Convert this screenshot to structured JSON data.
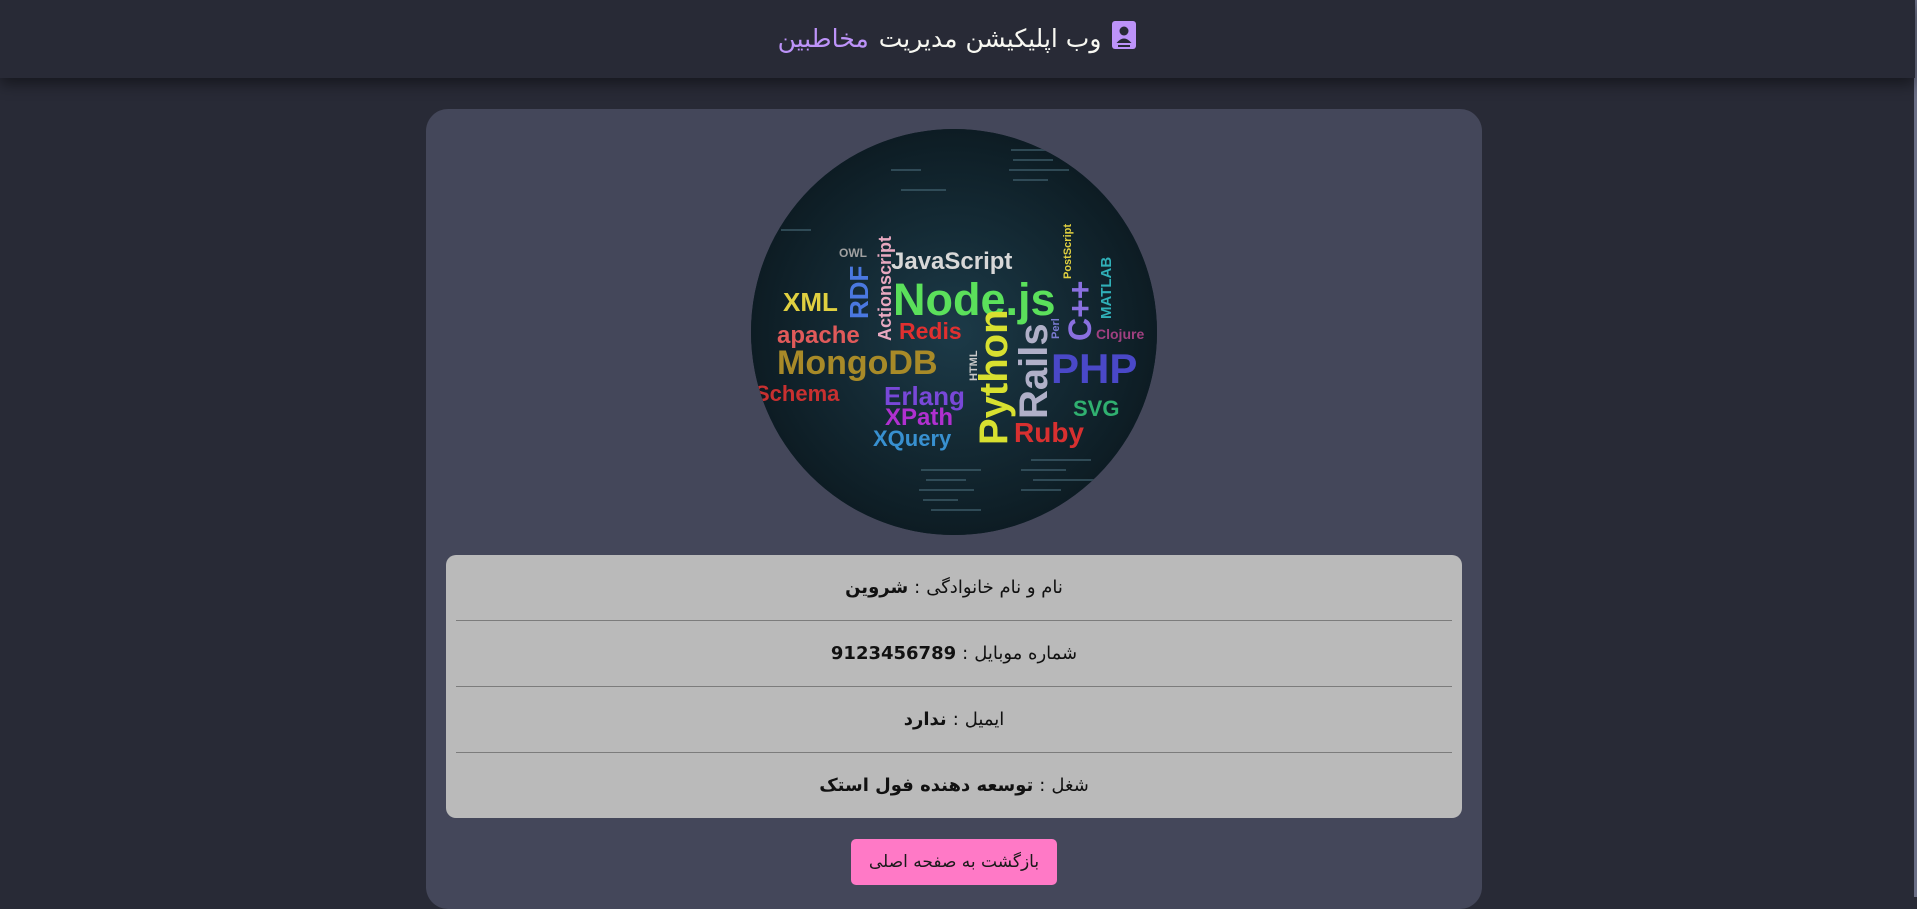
{
  "navbar": {
    "title": "وب اپلیکیشن مدیریت",
    "title_accent": "مخاطبین",
    "icon": "address-book-icon",
    "accent_color": "#bd93f9"
  },
  "contact": {
    "photo_words": [
      "JavaScript",
      "Node.js",
      "XML",
      "RDF",
      "Actionscript",
      "OWL",
      "apache",
      "Redis",
      "MongoDB",
      "HTML",
      "Python",
      "Rails",
      "Perl",
      "C++",
      "PHP",
      "MATLAB",
      "PostScript",
      "Clojure",
      "Schema",
      "Erlang",
      "XPath",
      "XQuery",
      "Ruby",
      "SVG"
    ],
    "fields": [
      {
        "label": "نام و نام خانوادگی",
        "value": "شروین"
      },
      {
        "label": "شماره موبایل",
        "value": "9123456789"
      },
      {
        "label": "ایمیل",
        "value": "ندارد"
      },
      {
        "label": "شغل",
        "value": "توسعه دهنده فول استک"
      }
    ],
    "separator": ":"
  },
  "actions": {
    "back_label": "بازگشت به صفحه اصلی",
    "back_color": "#ff79c6"
  }
}
